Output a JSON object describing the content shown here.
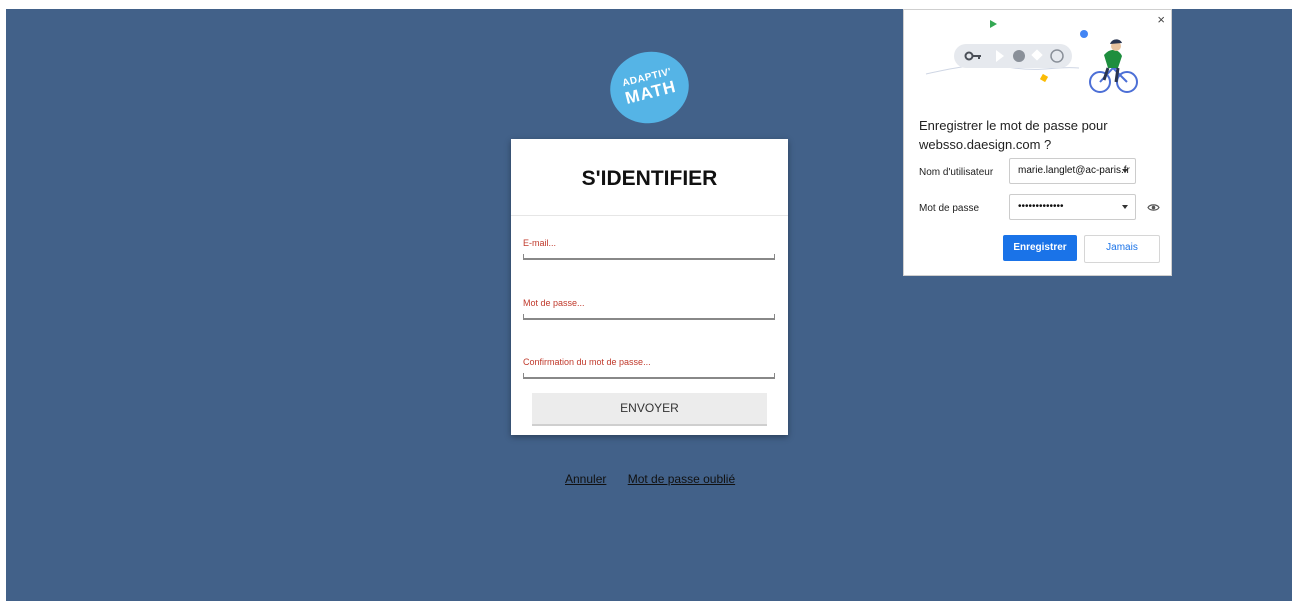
{
  "logo": {
    "line1": "ADAPTIV'",
    "line2": "MATH"
  },
  "login": {
    "title": "S'IDENTIFIER",
    "fields": [
      {
        "label": "E-mail..."
      },
      {
        "label": "Mot de passe..."
      },
      {
        "label": "Confirmation du mot de passe..."
      }
    ],
    "submit_label": "ENVOYER"
  },
  "links": {
    "cancel": "Annuler",
    "forgot": "Mot de passe oublié"
  },
  "password_popup": {
    "close": "×",
    "title": "Enregistrer le mot de passe pour websso.daesign.com ?",
    "username_label": "Nom d'utilisateur",
    "username_value": "marie.langlet@ac-paris.fr",
    "password_label": "Mot de passe",
    "password_value": "•••••••••••••",
    "save_label": "Enregistrer",
    "never_label": "Jamais",
    "icons": [
      "key-icon",
      "eye-icon",
      "cyclist-illustration"
    ]
  },
  "colors": {
    "background": "#426189",
    "logo": "#55b4e6",
    "label_red": "#c0392b",
    "primary": "#1a73e8"
  }
}
